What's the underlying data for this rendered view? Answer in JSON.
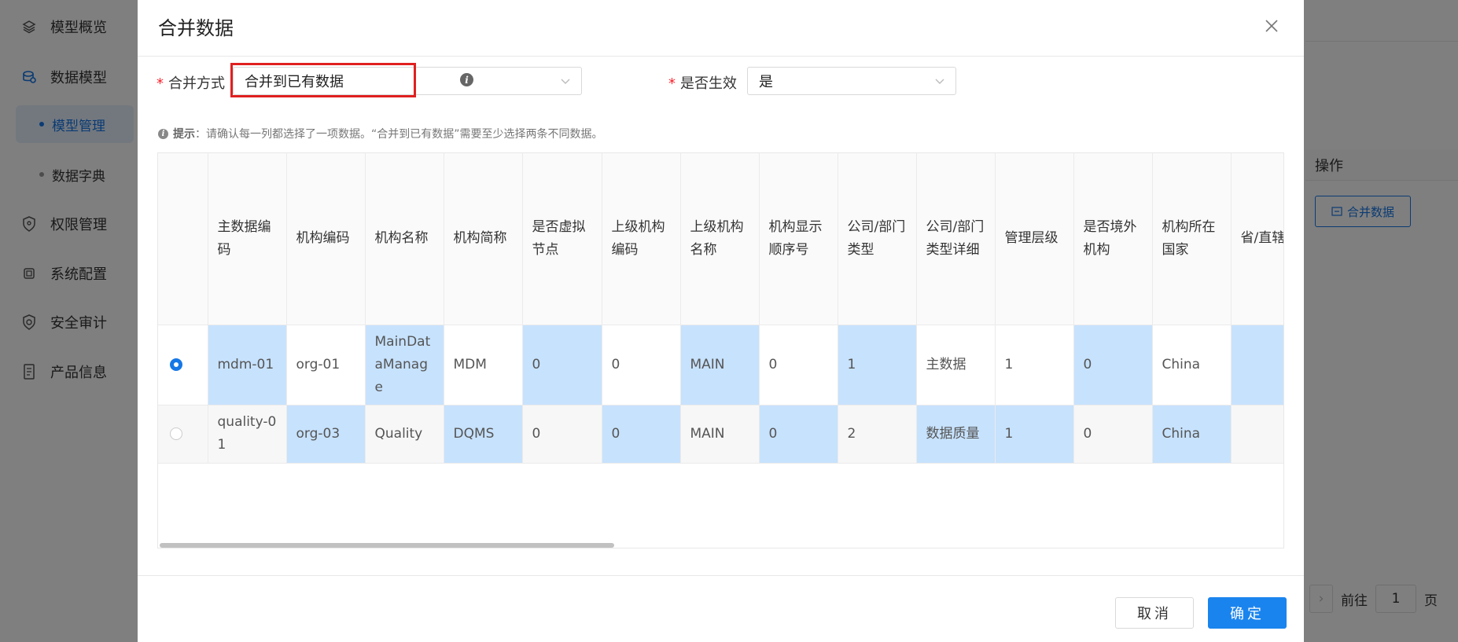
{
  "sidebar": {
    "items": [
      {
        "label": "模型概览",
        "icon": "layers-icon"
      },
      {
        "label": "数据模型",
        "icon": "database-icon"
      },
      {
        "label": "模型管理"
      },
      {
        "label": "数据字典"
      },
      {
        "label": "权限管理",
        "icon": "shield-icon"
      },
      {
        "label": "系统配置",
        "icon": "chip-icon"
      },
      {
        "label": "安全审计",
        "icon": "shield-check-icon"
      },
      {
        "label": "产品信息",
        "icon": "document-icon"
      }
    ]
  },
  "background": {
    "ops_header": "操作",
    "merge_button": "合并数据",
    "pager": {
      "goto": "前往",
      "page": "1",
      "page_suffix": "页"
    }
  },
  "modal": {
    "title": "合并数据",
    "merge_mode": {
      "label": "合并方式",
      "value": "合并到已有数据"
    },
    "is_active": {
      "label": "是否生效",
      "value": "是"
    },
    "hint": {
      "prefix": "提示",
      "text": "：请确认每一列都选择了一项数据。“合并到已有数据”需要至少选择两条不同数据。"
    },
    "table": {
      "columns": [
        "主数据编码",
        "机构编码",
        "机构名称",
        "机构简称",
        "是否虚拟节点",
        "上级机构编码",
        "上级机构名称",
        "机构显示顺序号",
        "公司/部门类型",
        "公司/部门类型详细",
        "管理层级",
        "是否境外机构",
        "机构所在国家",
        "省/直辖市"
      ],
      "rows": [
        {
          "checked": true,
          "cells": [
            "mdm-01",
            "org-01",
            "MainDataManage",
            "MDM",
            "0",
            "0",
            "MAIN",
            "0",
            "1",
            "主数据",
            "1",
            "0",
            "China",
            ""
          ]
        },
        {
          "checked": false,
          "cells": [
            "quality-01",
            "org-03",
            "Quality",
            "DQMS",
            "0",
            "0",
            "MAIN",
            "0",
            "2",
            "数据质量",
            "1",
            "0",
            "China",
            ""
          ]
        }
      ]
    },
    "cancel_label": "取消",
    "ok_label": "确定"
  },
  "colors": {
    "accent": "#1a84ee",
    "selected_cell": "#c7e2fd",
    "required": "#f5222d",
    "highlight": "#e02020"
  }
}
